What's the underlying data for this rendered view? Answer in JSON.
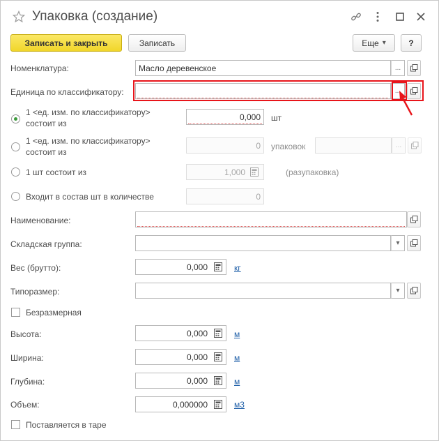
{
  "window": {
    "title": "Упаковка (создание)"
  },
  "toolbar": {
    "save_close_label": "Записать и закрыть",
    "save_label": "Записать",
    "more_label": "Еще",
    "help_label": "?"
  },
  "fields": {
    "nomenclature": {
      "label": "Номенклатура:",
      "value": "Масло деревенское"
    },
    "classifier_unit": {
      "label": "Единица по классификатору:",
      "value": ""
    },
    "option1": {
      "label_line1": "1 <ед. изм. по классификатору>",
      "label_line2": "состоит из",
      "value": "0,000",
      "unit": "шт",
      "selected": true
    },
    "option2": {
      "label_line1": "1 <ед. изм. по классификатору>",
      "label_line2": "состоит из",
      "value": "0",
      "unit": "упаковок",
      "package_value": ""
    },
    "option3": {
      "label": "1 шт состоит из",
      "value": "1,000",
      "unit": "(разупаковка)"
    },
    "option4": {
      "label": "Входит в состав шт в количестве",
      "value": "0"
    },
    "name": {
      "label": "Наименование:",
      "value": ""
    },
    "warehouse_group": {
      "label": "Складская группа:",
      "value": ""
    },
    "weight": {
      "label": "Вес (брутто):",
      "value": "0,000",
      "unit": "кг"
    },
    "size_type": {
      "label": "Типоразмер:",
      "value": ""
    },
    "dimensionless": {
      "label": "Безразмерная",
      "checked": false
    },
    "height": {
      "label": "Высота:",
      "value": "0,000",
      "unit": "м"
    },
    "width": {
      "label": "Ширина:",
      "value": "0,000",
      "unit": "м"
    },
    "depth": {
      "label": "Глубина:",
      "value": "0,000",
      "unit": "м"
    },
    "volume": {
      "label": "Объем:",
      "value": "0,000000",
      "unit": "м3"
    },
    "in_container": {
      "label": "Поставляется в таре",
      "checked": false
    }
  },
  "glyphs": {
    "ellipsis": "...",
    "dropdown": "▾"
  },
  "colors": {
    "primary_button": "#f1d62a",
    "highlight": "#e8141a",
    "link": "#1f5fa8",
    "radio_selected": "#3c9a3c"
  },
  "icons": [
    "star-icon",
    "link-icon",
    "more-vertical-icon",
    "maximize-icon",
    "close-icon",
    "open-icon",
    "calculator-icon",
    "arrow-icon"
  ]
}
